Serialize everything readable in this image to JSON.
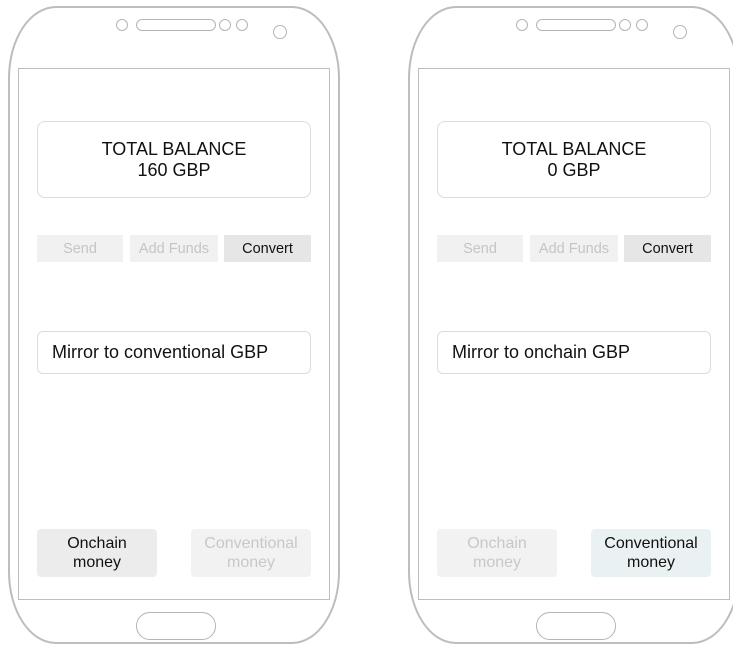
{
  "left_phone": {
    "balance_title": "TOTAL BALANCE",
    "balance_value": "160 GBP",
    "actions": {
      "send": "Send",
      "add_funds": "Add Funds",
      "convert": "Convert"
    },
    "mirror_field": "Mirror to conventional GBP",
    "money_tabs": {
      "onchain_line1": "Onchain",
      "onchain_line2": "money",
      "conventional_line1": "Conventional",
      "conventional_line2": "money"
    },
    "selected_tab": "onchain"
  },
  "right_phone": {
    "balance_title": "TOTAL BALANCE",
    "balance_value": "0 GBP",
    "actions": {
      "send": "Send",
      "add_funds": "Add Funds",
      "convert": "Convert"
    },
    "mirror_field": "Mirror to onchain GBP",
    "money_tabs": {
      "onchain_line1": "Onchain",
      "onchain_line2": "money",
      "conventional_line1": "Conventional",
      "conventional_line2": "money"
    },
    "selected_tab": "conventional"
  },
  "colors": {
    "phone_outline": "#bdbdbd",
    "active_button_bg": "#e6e6e6",
    "disabled_text": "#c5c5c5",
    "conventional_active_bg": "#eaf1f3"
  }
}
